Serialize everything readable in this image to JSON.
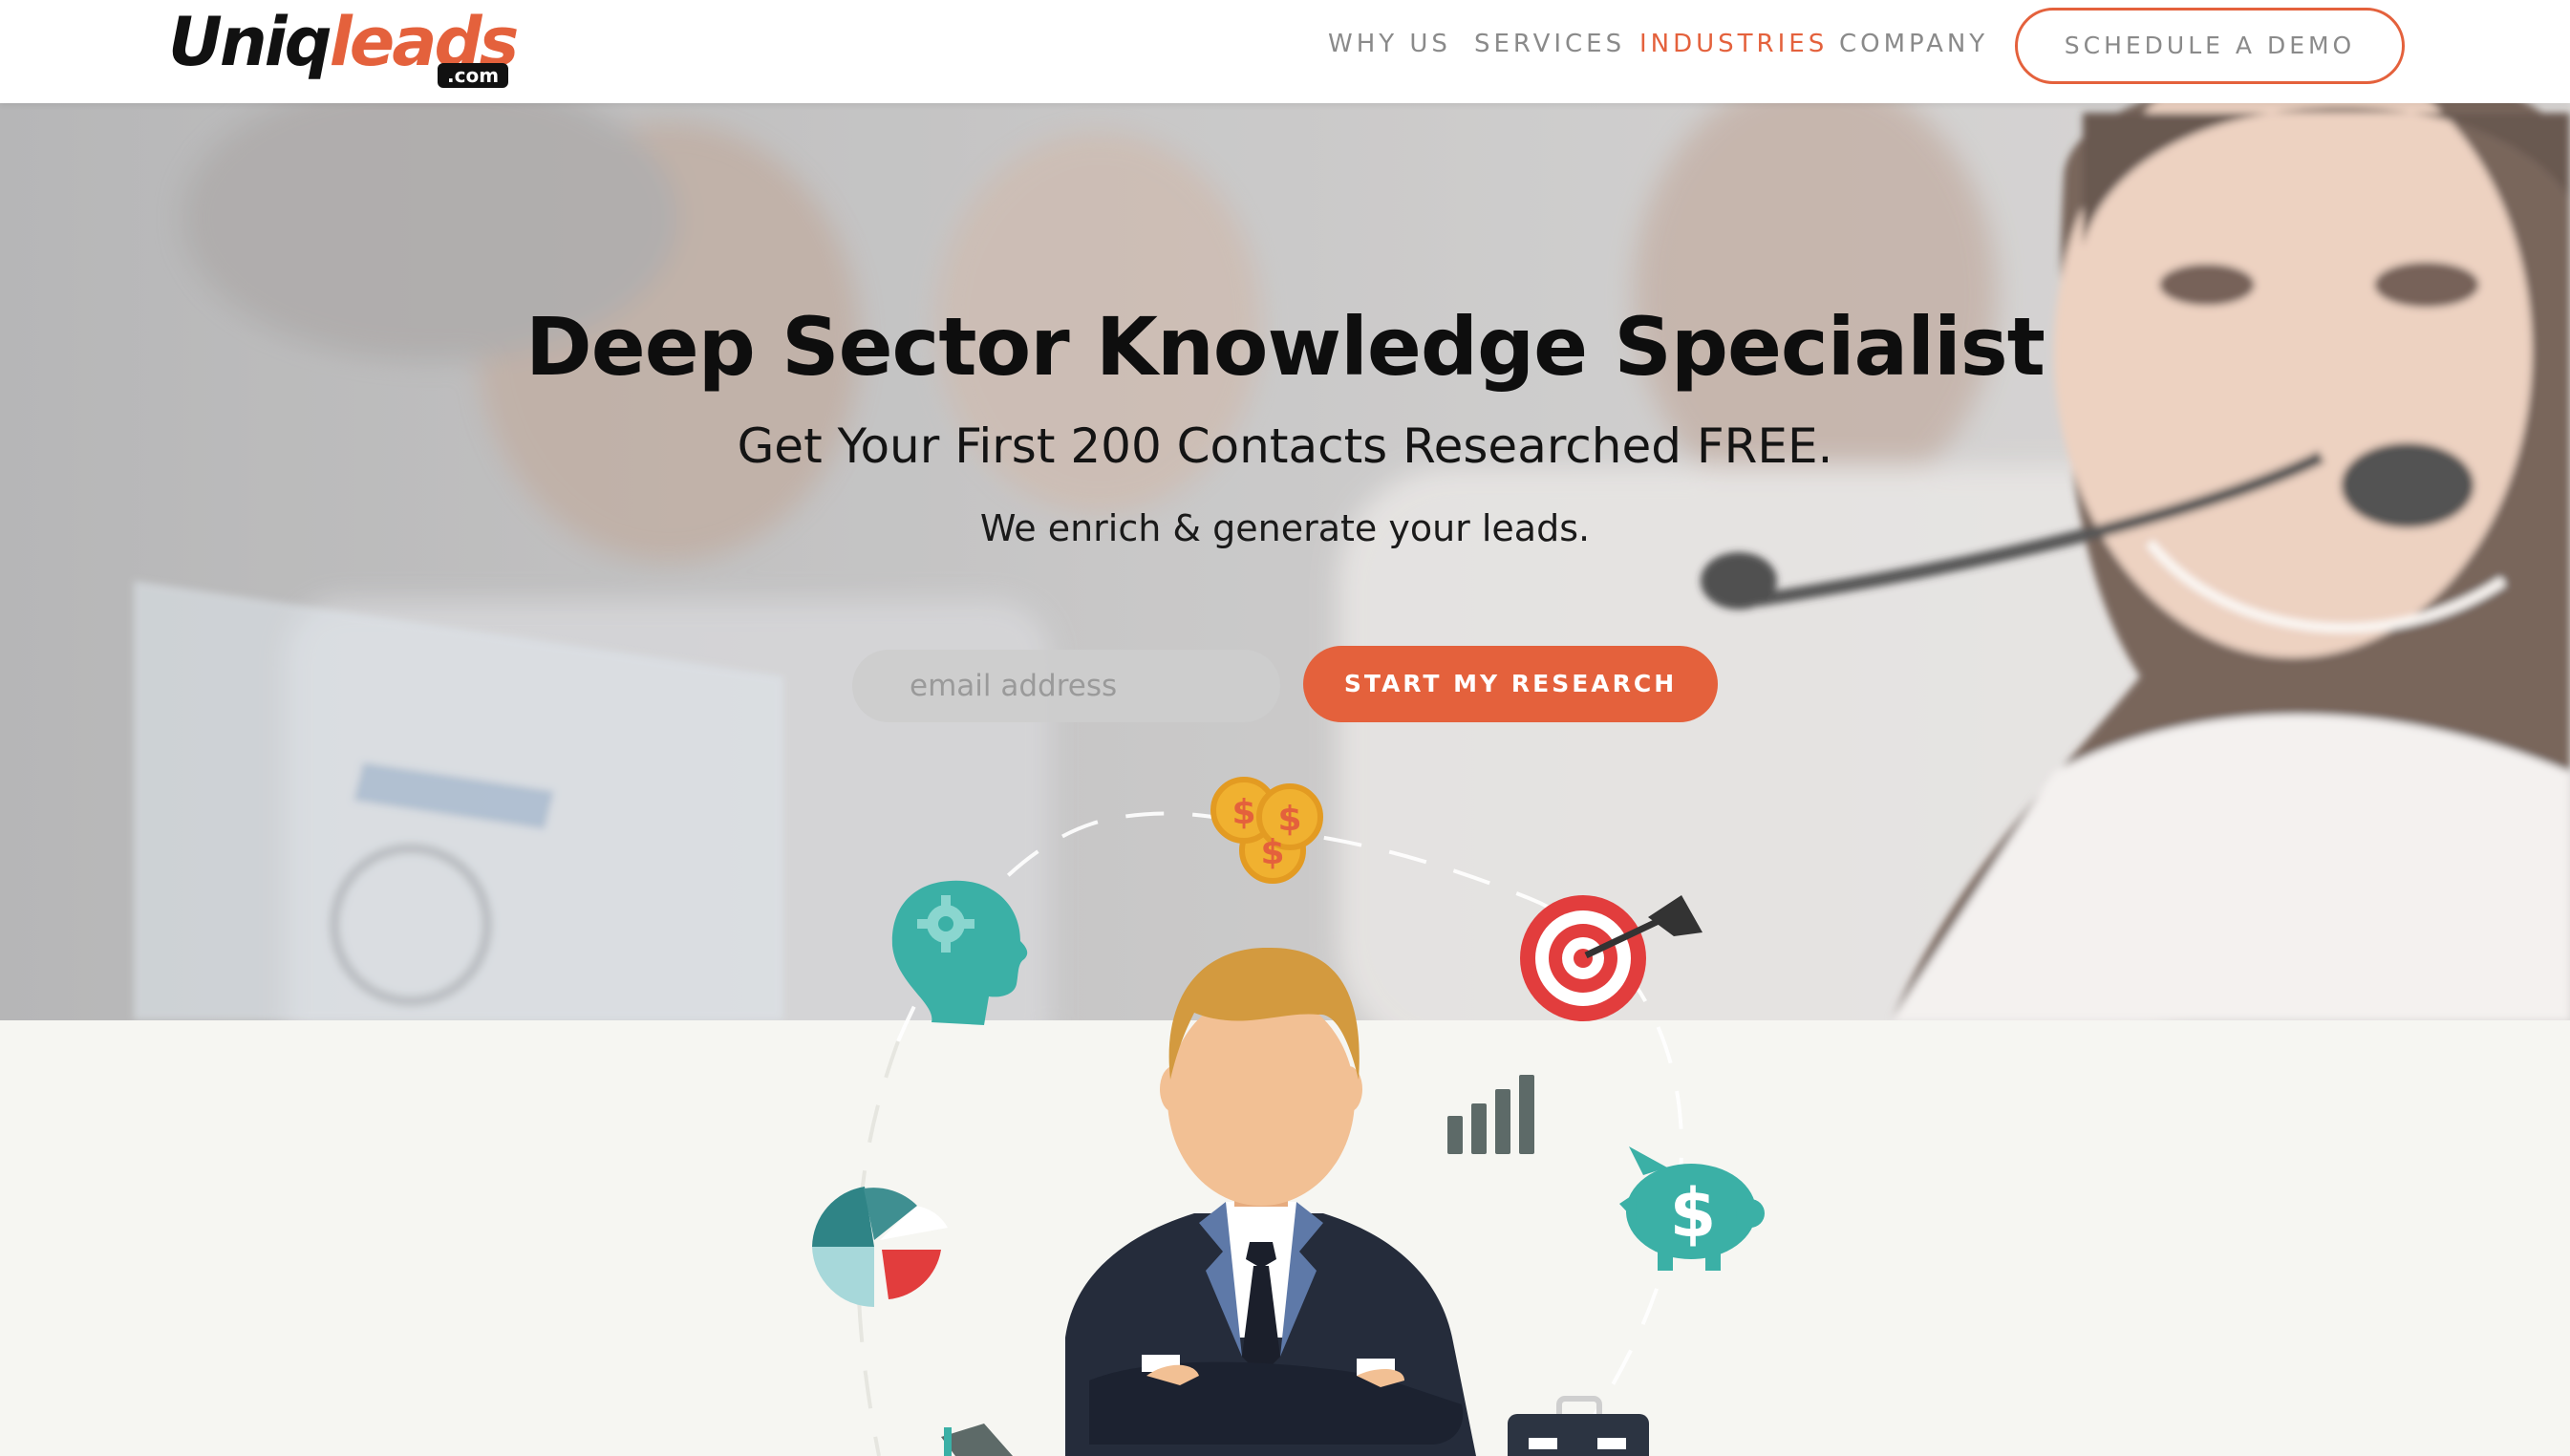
{
  "brand": {
    "name_part1": "Uniq",
    "name_part2": "leads",
    "suffix": ".com",
    "accent_color": "#e4613c"
  },
  "nav": {
    "items": [
      {
        "label": "WHY US",
        "active": false
      },
      {
        "label": "SERVICES",
        "active": false
      },
      {
        "label": "INDUSTRIES",
        "active": true
      },
      {
        "label": "COMPANY",
        "active": false
      }
    ],
    "cta_label": "SCHEDULE A DEMO"
  },
  "hero": {
    "title": "Deep Sector Knowledge Specialist",
    "subtitle": "Get Your First 200 Contacts Researched FREE.",
    "tagline": "We enrich & generate your leads.",
    "email_placeholder": "email address",
    "email_value": "",
    "submit_label": "START MY RESEARCH"
  },
  "illustration": {
    "icons": [
      "coins-icon",
      "brain-gear-icon",
      "target-icon",
      "bar-chart-icon",
      "pie-chart-icon",
      "piggy-bank-icon",
      "briefcase-icon",
      "megaphone-icon",
      "businessman-icon"
    ]
  }
}
